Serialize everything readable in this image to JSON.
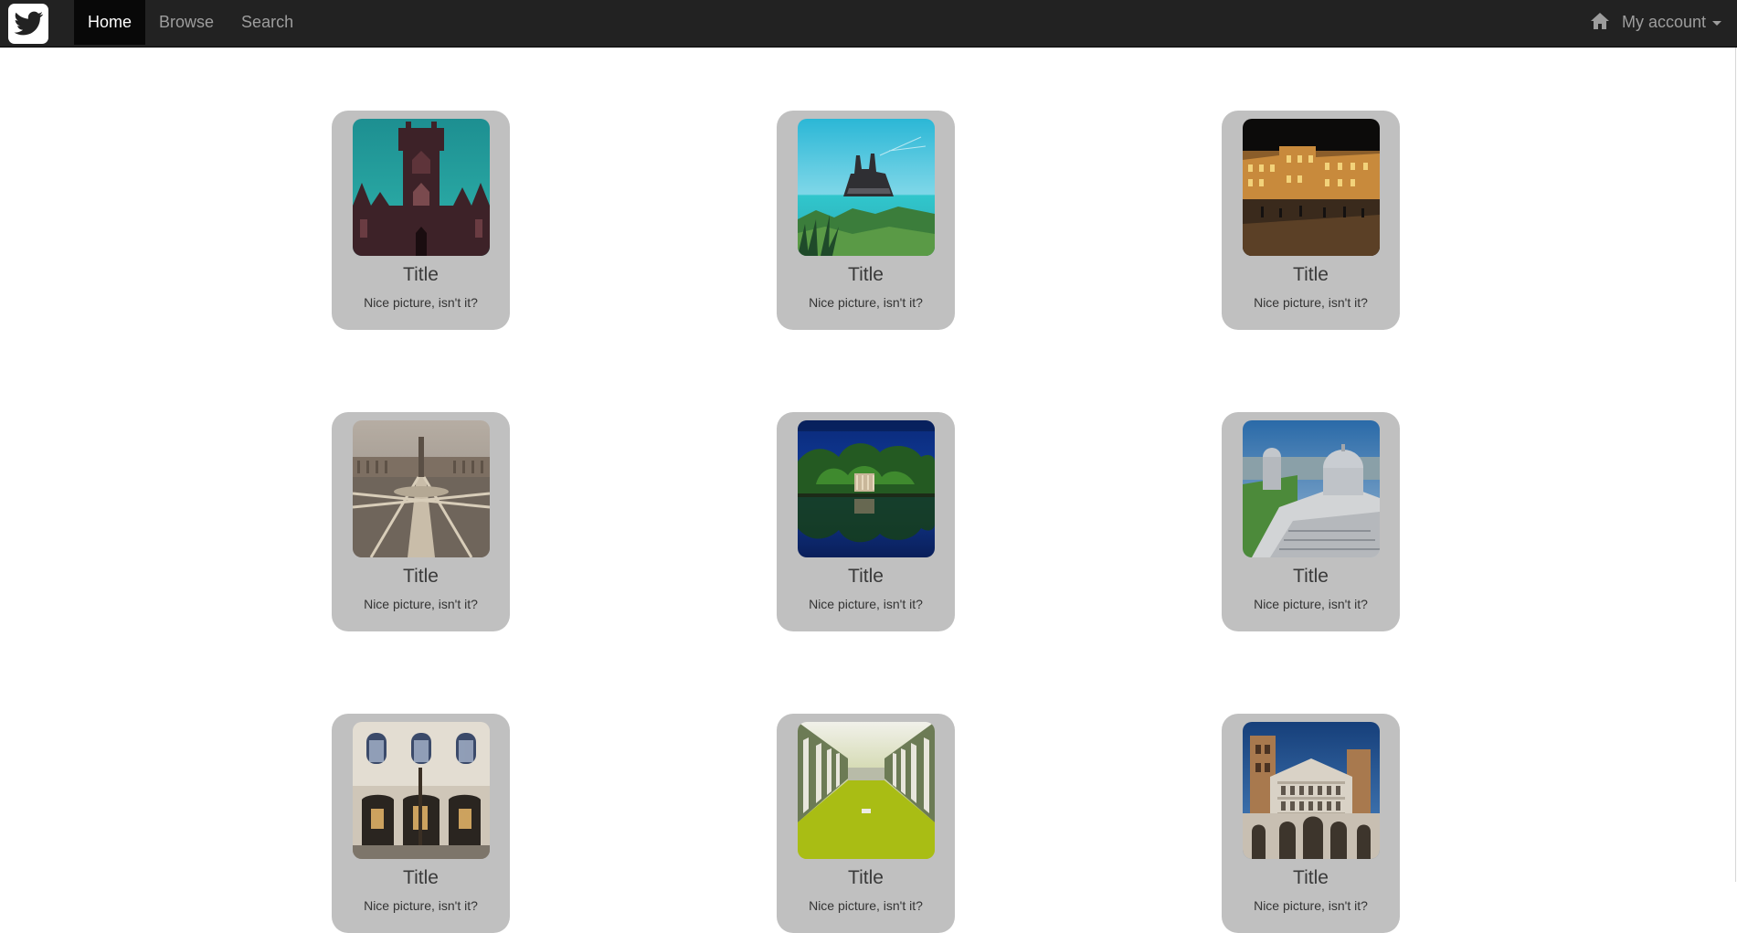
{
  "navbar": {
    "logo_icon": "twitter-bird-icon",
    "items": [
      {
        "label": "Home",
        "active": true
      },
      {
        "label": "Browse",
        "active": false
      },
      {
        "label": "Search",
        "active": false
      }
    ],
    "home_icon": "home-icon",
    "account_label": "My account"
  },
  "gallery": {
    "cards": [
      {
        "title": "Title",
        "caption": "Nice picture, isn't it?",
        "image": "gothic-church-photo"
      },
      {
        "title": "Title",
        "caption": "Nice picture, isn't it?",
        "image": "pirate-ship-photo"
      },
      {
        "title": "Title",
        "caption": "Nice picture, isn't it?",
        "image": "night-piazza-photo"
      },
      {
        "title": "Title",
        "caption": "Nice picture, isn't it?",
        "image": "st-peters-square-photo"
      },
      {
        "title": "Title",
        "caption": "Nice picture, isn't it?",
        "image": "lake-temple-photo"
      },
      {
        "title": "Title",
        "caption": "Nice picture, isn't it?",
        "image": "pisa-cathedral-photo"
      },
      {
        "title": "Title",
        "caption": "Nice picture, isn't it?",
        "image": "palazzo-courtyard-photo"
      },
      {
        "title": "Title",
        "caption": "Nice picture, isn't it?",
        "image": "camposanto-lawn-photo"
      },
      {
        "title": "Title",
        "caption": "Nice picture, isn't it?",
        "image": "romanesque-facade-photo"
      }
    ]
  },
  "colors": {
    "navbar_bg": "#222222",
    "active_nav_bg": "#080808",
    "card_bg": "#c0c0c0"
  }
}
